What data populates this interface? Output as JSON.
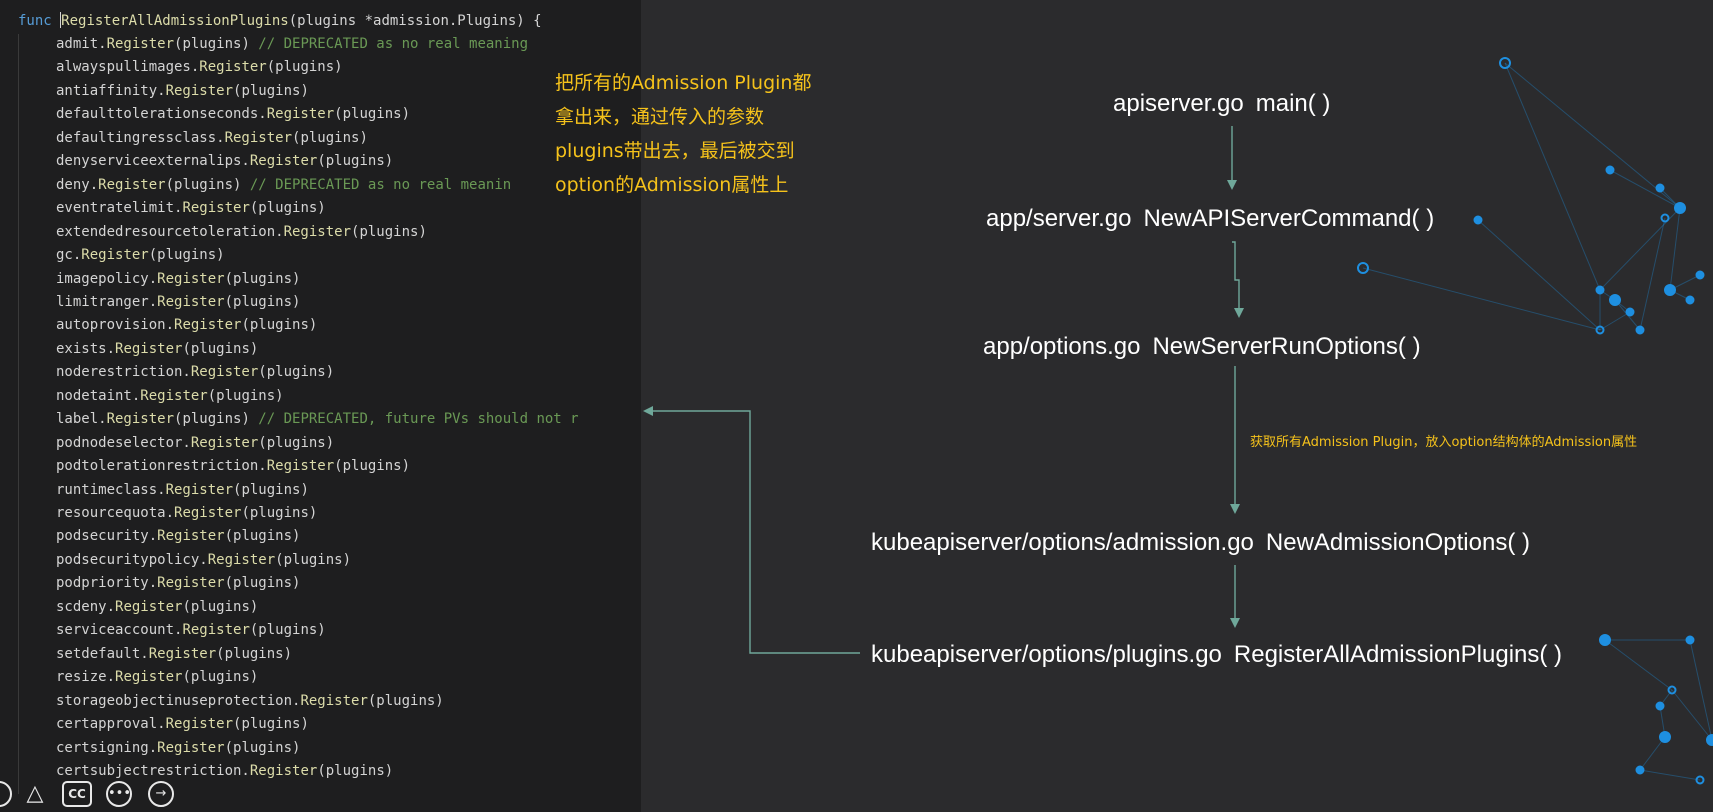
{
  "code": {
    "signature": {
      "keyword": "func",
      "name": "RegisterAllAdmissionPlugins",
      "params": "(plugins *admission.Plugins) {"
    },
    "lines": [
      {
        "pkg": "admit.",
        "call": "Register",
        "args": "(plugins)",
        "comment": " // DEPRECATED as no real meaning"
      },
      {
        "pkg": "alwayspullimages.",
        "call": "Register",
        "args": "(plugins)",
        "comment": ""
      },
      {
        "pkg": "antiaffinity.",
        "call": "Register",
        "args": "(plugins)",
        "comment": ""
      },
      {
        "pkg": "defaulttolerationseconds.",
        "call": "Register",
        "args": "(plugins)",
        "comment": ""
      },
      {
        "pkg": "defaultingressclass.",
        "call": "Register",
        "args": "(plugins)",
        "comment": ""
      },
      {
        "pkg": "denyserviceexternalips.",
        "call": "Register",
        "args": "(plugins)",
        "comment": ""
      },
      {
        "pkg": "deny.",
        "call": "Register",
        "args": "(plugins)",
        "comment": " // DEPRECATED as no real meanin"
      },
      {
        "pkg": "eventratelimit.",
        "call": "Register",
        "args": "(plugins)",
        "comment": ""
      },
      {
        "pkg": "extendedresourcetoleration.",
        "call": "Register",
        "args": "(plugins)",
        "comment": ""
      },
      {
        "pkg": "gc.",
        "call": "Register",
        "args": "(plugins)",
        "comment": ""
      },
      {
        "pkg": "imagepolicy.",
        "call": "Register",
        "args": "(plugins)",
        "comment": ""
      },
      {
        "pkg": "limitranger.",
        "call": "Register",
        "args": "(plugins)",
        "comment": ""
      },
      {
        "pkg": "autoprovision.",
        "call": "Register",
        "args": "(plugins)",
        "comment": ""
      },
      {
        "pkg": "exists.",
        "call": "Register",
        "args": "(plugins)",
        "comment": ""
      },
      {
        "pkg": "noderestriction.",
        "call": "Register",
        "args": "(plugins)",
        "comment": ""
      },
      {
        "pkg": "nodetaint.",
        "call": "Register",
        "args": "(plugins)",
        "comment": ""
      },
      {
        "pkg": "label.",
        "call": "Register",
        "args": "(plugins)",
        "comment": " // DEPRECATED, future PVs should not r"
      },
      {
        "pkg": "podnodeselector.",
        "call": "Register",
        "args": "(plugins)",
        "comment": ""
      },
      {
        "pkg": "podtolerationrestriction.",
        "call": "Register",
        "args": "(plugins)",
        "comment": ""
      },
      {
        "pkg": "runtimeclass.",
        "call": "Register",
        "args": "(plugins)",
        "comment": ""
      },
      {
        "pkg": "resourcequota.",
        "call": "Register",
        "args": "(plugins)",
        "comment": ""
      },
      {
        "pkg": "podsecurity.",
        "call": "Register",
        "args": "(plugins)",
        "comment": ""
      },
      {
        "pkg": "podsecuritypolicy.",
        "call": "Register",
        "args": "(plugins)",
        "comment": ""
      },
      {
        "pkg": "podpriority.",
        "call": "Register",
        "args": "(plugins)",
        "comment": ""
      },
      {
        "pkg": "scdeny.",
        "call": "Register",
        "args": "(plugins)",
        "comment": ""
      },
      {
        "pkg": "serviceaccount.",
        "call": "Register",
        "args": "(plugins)",
        "comment": ""
      },
      {
        "pkg": "setdefault.",
        "call": "Register",
        "args": "(plugins)",
        "comment": ""
      },
      {
        "pkg": "resize.",
        "call": "Register",
        "args": "(plugins)",
        "comment": ""
      },
      {
        "pkg": "storageobjectinuseprotection.",
        "call": "Register",
        "args": "(plugins)",
        "comment": ""
      },
      {
        "pkg": "certapproval.",
        "call": "Register",
        "args": "(plugins)",
        "comment": ""
      },
      {
        "pkg": "certsigning.",
        "call": "Register",
        "args": "(plugins)",
        "comment": ""
      },
      {
        "pkg": "certsubjectrestriction.",
        "call": "Register",
        "args": "(plugins)",
        "comment": ""
      }
    ]
  },
  "annotation": "把所有的Admission Plugin都\n拿出来，通过传入的参数\nplugins带出去，最后被交到\noption的Admission属性上",
  "flow": {
    "nodes": [
      {
        "file": "apiserver.go",
        "func": "main( )"
      },
      {
        "file": "app/server.go",
        "func": "NewAPIServerCommand( )"
      },
      {
        "file": "app/options.go",
        "func": "NewServerRunOptions( )"
      },
      {
        "file": "kubeapiserver/options/admission.go",
        "func": "NewAdmissionOptions( )"
      },
      {
        "file": "kubeapiserver/options/plugins.go",
        "func": "RegisterAllAdmissionPlugins( )"
      }
    ],
    "step_note": "获取所有Admission Plugin，放入option结构体的Admission属性"
  },
  "player": {
    "cc_label": "CC",
    "more_label": "•••",
    "next_label": "→"
  },
  "colors": {
    "keyword": "#569cd6",
    "function": "#dcdcaa",
    "comment": "#6a9955",
    "annotation": "#f5c21b",
    "arrow": "#6fa89a",
    "network": "#1e8fe0"
  }
}
